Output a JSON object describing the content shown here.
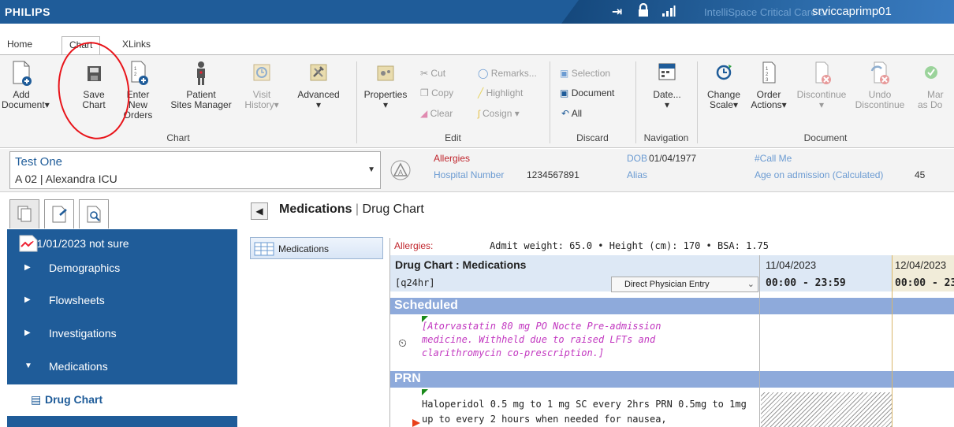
{
  "titlebar": {
    "brand": "PHILIPS",
    "product": "IntelliSpace Critical Care ar",
    "server": "srviccaprimp01"
  },
  "tabs": [
    {
      "label": "Home"
    },
    {
      "label": "Chart"
    },
    {
      "label": "XLinks"
    }
  ],
  "ribbon": {
    "chart_group": {
      "label": "Chart",
      "buttons": [
        {
          "line1": "Add",
          "line2": "Document▾"
        },
        {
          "line1": "Save",
          "line2": "Chart"
        },
        {
          "line1": "Enter",
          "line2": "New Orders"
        },
        {
          "line1": "Patient",
          "line2": "Sites Manager"
        },
        {
          "line1": "Visit",
          "line2": "History▾"
        },
        {
          "line1": "Advanced",
          "line2": "▾"
        }
      ]
    },
    "edit_group": {
      "label": "Edit",
      "properties": {
        "line1": "Properties",
        "line2": "▾"
      },
      "cut": "Cut",
      "copy": "Copy",
      "clear": "Clear",
      "remarks": "Remarks...",
      "highlight": "Highlight",
      "cosign": "Cosign ▾"
    },
    "discard_group": {
      "label": "Discard",
      "selection": "Selection",
      "document": "Document",
      "all": "All"
    },
    "navigation_group": {
      "label": "Navigation",
      "date": {
        "line1": "Date...",
        "line2": "▾"
      }
    },
    "document_group": {
      "label": "Document",
      "buttons": [
        {
          "line1": "Change",
          "line2": "Scale▾"
        },
        {
          "line1": "Order",
          "line2": "Actions▾"
        },
        {
          "line1": "Discontinue",
          "line2": "▾"
        },
        {
          "line1": "Undo",
          "line2": "Discontinue"
        },
        {
          "line1": "Mar",
          "line2": "as Do"
        }
      ]
    }
  },
  "patient": {
    "name": "Test One",
    "location": "A 02 | Alexandra ICU",
    "allergies_label": "Allergies",
    "hospital_number_label": "Hospital Number",
    "hospital_number": "1234567891",
    "dob_label": "DOB",
    "dob": "01/04/1977",
    "alias_label": "Alias",
    "call_me": "#Call Me",
    "age_label": "Age on admission (Calculated)",
    "age": "45"
  },
  "nav": {
    "items": [
      {
        "label": "31/01/2023 not sure"
      },
      {
        "label": "Demographics"
      },
      {
        "label": "Flowsheets"
      },
      {
        "label": "Investigations"
      },
      {
        "label": "Medications"
      },
      {
        "label": "Drug Chart"
      }
    ]
  },
  "main": {
    "breadcrumb_bold": "Medications",
    "breadcrumb_sep": "|",
    "breadcrumb_rest": "Drug Chart",
    "side_button": "Medications",
    "allergies_label": "Allergies:",
    "metrics": "Admit weight: 65.0  •  Height (cm): 170  •  BSA: 1.75",
    "chart_title": "Drug Chart : Medications",
    "frequency": "[q24hr]",
    "entry_type": "Direct Physician Entry",
    "dates": [
      {
        "date": "11/04/2023",
        "range": "00:00 - 23:59"
      },
      {
        "date": "12/04/2023",
        "range": "00:00 - 23"
      }
    ],
    "sections": {
      "scheduled": "Scheduled",
      "prn": "PRN"
    },
    "scheduled_order": "[Atorvastatin 80 mg PO Nocte Pre-admission medicine. Withheld due to raised LFTs and clarithromycin co-prescription.]",
    "prn_order": "Haloperidol 0.5 mg to 1 mg SC every 2hrs PRN 0.5mg to 1mg up to every 2 hours when needed for nausea,"
  },
  "colors": {
    "brand_blue": "#1f5c99",
    "section_blue": "#8eaadb",
    "allergy_red": "#c0262d",
    "annotation_red": "#e8141a",
    "order_magenta": "#c238c0"
  }
}
